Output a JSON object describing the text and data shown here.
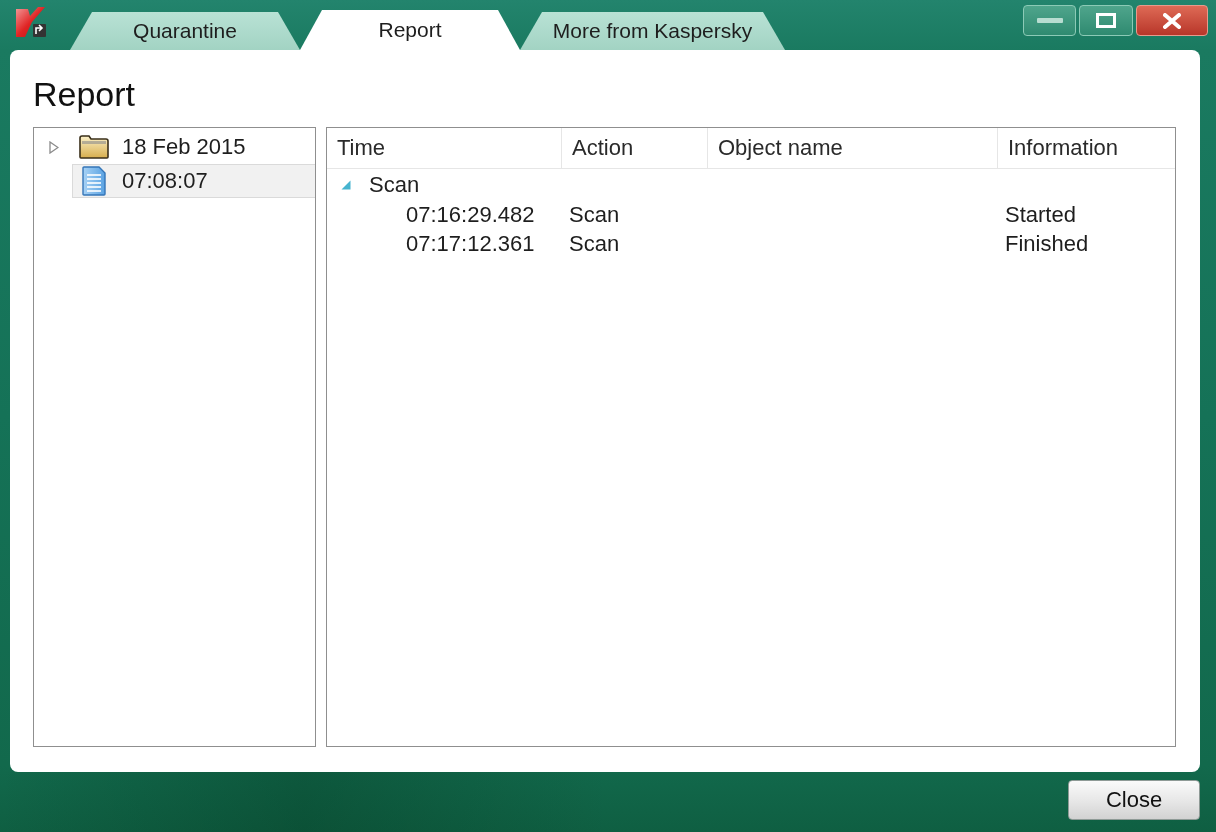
{
  "tabs": [
    {
      "label": "Quarantine",
      "selected": false
    },
    {
      "label": "Report",
      "selected": true
    },
    {
      "label": "More from Kaspersky",
      "selected": false
    }
  ],
  "heading": "Report",
  "tree": {
    "items": [
      {
        "kind": "folder",
        "label": "18 Feb 2015",
        "expanded": false,
        "selected": false
      },
      {
        "kind": "document",
        "label": "07:08:07",
        "selected": true
      }
    ]
  },
  "table": {
    "columns": [
      "Time",
      "Action",
      "Object name",
      "Information"
    ],
    "groups": [
      {
        "label": "Scan",
        "expanded": true,
        "rows": [
          {
            "time": "07:16:29.482",
            "action": "Scan",
            "information": "Started"
          },
          {
            "time": "07:17:12.361",
            "action": "Scan",
            "information": "Finished"
          }
        ]
      }
    ]
  },
  "buttons": [
    {
      "label": "Close"
    }
  ]
}
